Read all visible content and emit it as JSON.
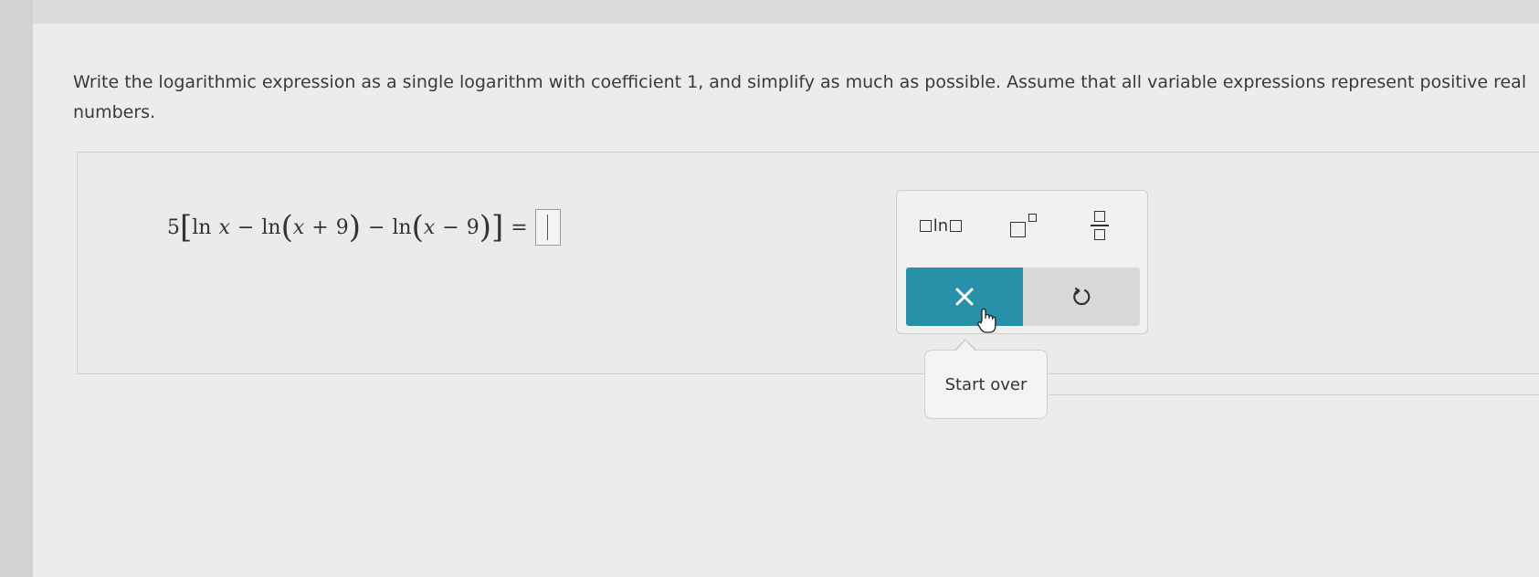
{
  "question": {
    "text": "Write the logarithmic expression as a single logarithm with coefficient 1, and simplify as much as possible. Assume that all variable expressions represent positive real numbers."
  },
  "expression": {
    "coef": "5",
    "lbracket": "[",
    "ln1": "ln",
    "x1": "x",
    "minus1": "−",
    "ln2": "ln",
    "lparen1": "(",
    "x2": "x",
    "plus": "+",
    "nine1": "9",
    "rparen1": ")",
    "minus2": "−",
    "ln3": "ln",
    "lparen2": "(",
    "x3": "x",
    "minus3": "−",
    "nine2": "9",
    "rparen2": ")",
    "rbracket": "]",
    "equals": "="
  },
  "palette": {
    "ln_label": "ln",
    "ln_icon": "ln-template-icon",
    "exponent_icon": "exponent-template-icon",
    "fraction_icon": "fraction-template-icon",
    "clear_icon": "x-icon",
    "undo_icon": "undo-icon",
    "accent_color": "#2691a8"
  },
  "tooltip": {
    "text": "Start over"
  }
}
